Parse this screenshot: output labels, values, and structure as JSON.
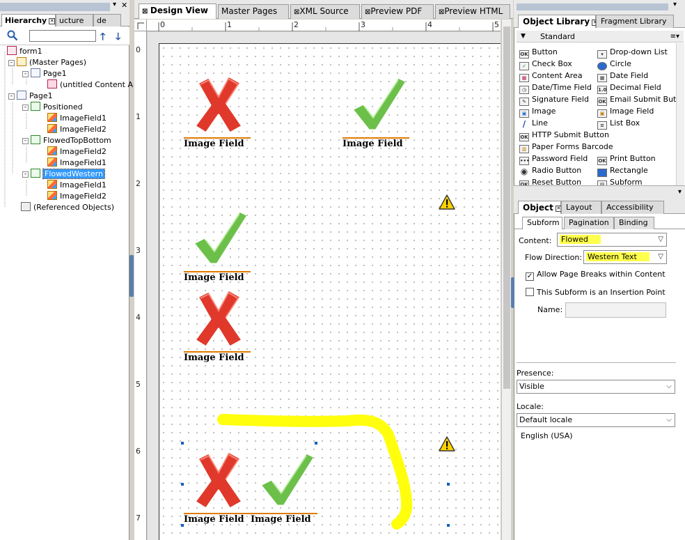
{
  "hierarchy": {
    "tabs": [
      {
        "label": "Hierarchy",
        "active": true
      },
      {
        "label": "ucture"
      },
      {
        "label": "de"
      }
    ],
    "search_placeholder": "",
    "tree": [
      {
        "label": "form1",
        "icon": "form"
      },
      {
        "label": "(Master Pages)",
        "icon": "master"
      },
      {
        "label": "Page1",
        "icon": "page"
      },
      {
        "label": "(untitled Content A",
        "icon": "content"
      },
      {
        "label": "Page1",
        "icon": "page"
      },
      {
        "label": "Positioned",
        "icon": "sub"
      },
      {
        "label": "ImageField1",
        "icon": "img"
      },
      {
        "label": "ImageField2",
        "icon": "img"
      },
      {
        "label": "FlowedTopBottom",
        "icon": "sub"
      },
      {
        "label": "ImageField2",
        "icon": "img"
      },
      {
        "label": "ImageField1",
        "icon": "img"
      },
      {
        "label": "FlowedWestern",
        "icon": "sub",
        "selected": true
      },
      {
        "label": "ImageField1",
        "icon": "img"
      },
      {
        "label": "ImageField2",
        "icon": "img"
      },
      {
        "label": "(Referenced Objects)",
        "icon": "ref"
      }
    ]
  },
  "center": {
    "tabs": [
      {
        "label": "Design View",
        "active": true
      },
      {
        "label": "Master Pages"
      },
      {
        "label": "XML Source"
      },
      {
        "label": "Preview PDF"
      },
      {
        "label": "Preview HTML"
      }
    ],
    "ruler_top": [
      "0",
      "1",
      "2",
      "3",
      "4",
      "5"
    ],
    "ruler_left": [
      "0",
      "1",
      "2",
      "3",
      "4",
      "5",
      "6",
      "7"
    ],
    "field_caption": "Image Field"
  },
  "library": {
    "tabs": [
      {
        "label": "Object Library",
        "active": true
      },
      {
        "label": "Fragment Library"
      }
    ],
    "group": "Standard",
    "items_left": [
      {
        "label": "Button",
        "icon": "OK"
      },
      {
        "label": "Check Box",
        "icon": "✓"
      },
      {
        "label": "Content Area",
        "icon": "▦"
      },
      {
        "label": "Date/Time Field",
        "icon": "◷"
      },
      {
        "label": "Signature Field",
        "icon": "✎"
      },
      {
        "label": "Image",
        "icon": "▣"
      },
      {
        "label": "Line",
        "icon": "/"
      },
      {
        "label": "HTTP Submit Button",
        "icon": "OK"
      },
      {
        "label": "Paper Forms Barcode",
        "icon": "▥"
      },
      {
        "label": "Password Field",
        "icon": "•••"
      },
      {
        "label": "Radio Button",
        "icon": "◉"
      },
      {
        "label": "Reset Button",
        "icon": "OK"
      }
    ],
    "items_right": [
      {
        "label": "Drop-down List",
        "icon": "▾"
      },
      {
        "label": "Circle",
        "icon": "○"
      },
      {
        "label": "Date Field",
        "icon": "▦"
      },
      {
        "label": "Decimal Field",
        "icon": "1.0"
      },
      {
        "label": "Email Submit Button",
        "icon": "OK"
      },
      {
        "label": "Image Field",
        "icon": "▣"
      },
      {
        "label": "List Box",
        "icon": "≡"
      },
      {
        "label": "Print Button",
        "icon": "OK"
      },
      {
        "label": "Rectangle",
        "icon": "□"
      },
      {
        "label": "Subform",
        "icon": "▤"
      }
    ]
  },
  "object": {
    "tabs": [
      {
        "label": "Object",
        "active": true
      },
      {
        "label": "Layout"
      },
      {
        "label": "Accessibility"
      }
    ],
    "subtabs": [
      {
        "label": "Subform",
        "active": true
      },
      {
        "label": "Pagination"
      },
      {
        "label": "Binding"
      }
    ],
    "content_label": "Content:",
    "content_value": "Flowed",
    "flow_label": "Flow Direction:",
    "flow_value": "Western Text",
    "allow_breaks": "Allow Page Breaks within Content",
    "allow_breaks_checked": true,
    "insertion_point": "This Subform is an Insertion Point",
    "insertion_checked": false,
    "name_label": "Name:",
    "presence_label": "Presence:",
    "presence_value": "Visible",
    "locale_label": "Locale:",
    "locale_value": "Default locale",
    "locale_note": "English (USA)"
  },
  "colors": {
    "highlight": "#ffff4d",
    "selection": "#3399ff",
    "field_underline": "#e07a00",
    "x_red": "#e0392b",
    "check_green": "#6cc04a",
    "annotation_yellow": "#ffff00"
  }
}
